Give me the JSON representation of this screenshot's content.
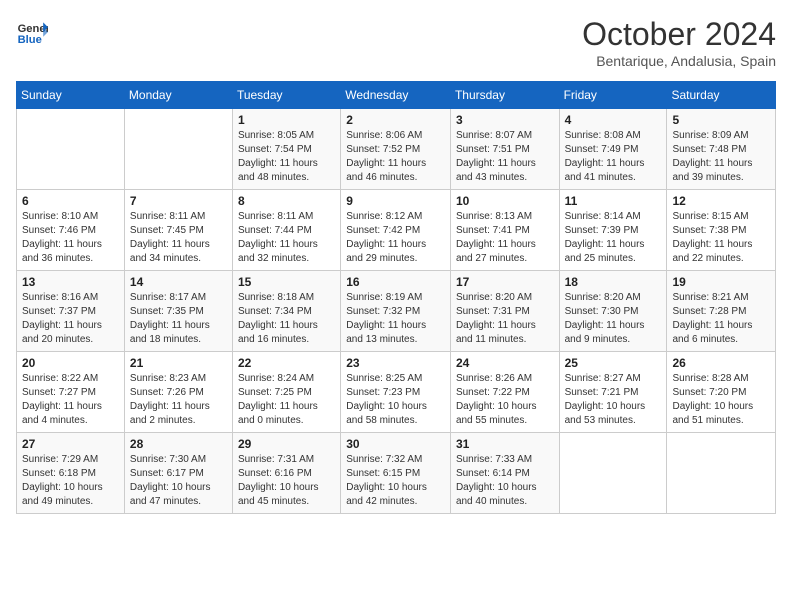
{
  "header": {
    "logo_line1": "General",
    "logo_line2": "Blue",
    "month": "October 2024",
    "location": "Bentarique, Andalusia, Spain"
  },
  "days_of_week": [
    "Sunday",
    "Monday",
    "Tuesday",
    "Wednesday",
    "Thursday",
    "Friday",
    "Saturday"
  ],
  "weeks": [
    [
      {
        "day": "",
        "info": ""
      },
      {
        "day": "",
        "info": ""
      },
      {
        "day": "1",
        "info": "Sunrise: 8:05 AM\nSunset: 7:54 PM\nDaylight: 11 hours and 48 minutes."
      },
      {
        "day": "2",
        "info": "Sunrise: 8:06 AM\nSunset: 7:52 PM\nDaylight: 11 hours and 46 minutes."
      },
      {
        "day": "3",
        "info": "Sunrise: 8:07 AM\nSunset: 7:51 PM\nDaylight: 11 hours and 43 minutes."
      },
      {
        "day": "4",
        "info": "Sunrise: 8:08 AM\nSunset: 7:49 PM\nDaylight: 11 hours and 41 minutes."
      },
      {
        "day": "5",
        "info": "Sunrise: 8:09 AM\nSunset: 7:48 PM\nDaylight: 11 hours and 39 minutes."
      }
    ],
    [
      {
        "day": "6",
        "info": "Sunrise: 8:10 AM\nSunset: 7:46 PM\nDaylight: 11 hours and 36 minutes."
      },
      {
        "day": "7",
        "info": "Sunrise: 8:11 AM\nSunset: 7:45 PM\nDaylight: 11 hours and 34 minutes."
      },
      {
        "day": "8",
        "info": "Sunrise: 8:11 AM\nSunset: 7:44 PM\nDaylight: 11 hours and 32 minutes."
      },
      {
        "day": "9",
        "info": "Sunrise: 8:12 AM\nSunset: 7:42 PM\nDaylight: 11 hours and 29 minutes."
      },
      {
        "day": "10",
        "info": "Sunrise: 8:13 AM\nSunset: 7:41 PM\nDaylight: 11 hours and 27 minutes."
      },
      {
        "day": "11",
        "info": "Sunrise: 8:14 AM\nSunset: 7:39 PM\nDaylight: 11 hours and 25 minutes."
      },
      {
        "day": "12",
        "info": "Sunrise: 8:15 AM\nSunset: 7:38 PM\nDaylight: 11 hours and 22 minutes."
      }
    ],
    [
      {
        "day": "13",
        "info": "Sunrise: 8:16 AM\nSunset: 7:37 PM\nDaylight: 11 hours and 20 minutes."
      },
      {
        "day": "14",
        "info": "Sunrise: 8:17 AM\nSunset: 7:35 PM\nDaylight: 11 hours and 18 minutes."
      },
      {
        "day": "15",
        "info": "Sunrise: 8:18 AM\nSunset: 7:34 PM\nDaylight: 11 hours and 16 minutes."
      },
      {
        "day": "16",
        "info": "Sunrise: 8:19 AM\nSunset: 7:32 PM\nDaylight: 11 hours and 13 minutes."
      },
      {
        "day": "17",
        "info": "Sunrise: 8:20 AM\nSunset: 7:31 PM\nDaylight: 11 hours and 11 minutes."
      },
      {
        "day": "18",
        "info": "Sunrise: 8:20 AM\nSunset: 7:30 PM\nDaylight: 11 hours and 9 minutes."
      },
      {
        "day": "19",
        "info": "Sunrise: 8:21 AM\nSunset: 7:28 PM\nDaylight: 11 hours and 6 minutes."
      }
    ],
    [
      {
        "day": "20",
        "info": "Sunrise: 8:22 AM\nSunset: 7:27 PM\nDaylight: 11 hours and 4 minutes."
      },
      {
        "day": "21",
        "info": "Sunrise: 8:23 AM\nSunset: 7:26 PM\nDaylight: 11 hours and 2 minutes."
      },
      {
        "day": "22",
        "info": "Sunrise: 8:24 AM\nSunset: 7:25 PM\nDaylight: 11 hours and 0 minutes."
      },
      {
        "day": "23",
        "info": "Sunrise: 8:25 AM\nSunset: 7:23 PM\nDaylight: 10 hours and 58 minutes."
      },
      {
        "day": "24",
        "info": "Sunrise: 8:26 AM\nSunset: 7:22 PM\nDaylight: 10 hours and 55 minutes."
      },
      {
        "day": "25",
        "info": "Sunrise: 8:27 AM\nSunset: 7:21 PM\nDaylight: 10 hours and 53 minutes."
      },
      {
        "day": "26",
        "info": "Sunrise: 8:28 AM\nSunset: 7:20 PM\nDaylight: 10 hours and 51 minutes."
      }
    ],
    [
      {
        "day": "27",
        "info": "Sunrise: 7:29 AM\nSunset: 6:18 PM\nDaylight: 10 hours and 49 minutes."
      },
      {
        "day": "28",
        "info": "Sunrise: 7:30 AM\nSunset: 6:17 PM\nDaylight: 10 hours and 47 minutes."
      },
      {
        "day": "29",
        "info": "Sunrise: 7:31 AM\nSunset: 6:16 PM\nDaylight: 10 hours and 45 minutes."
      },
      {
        "day": "30",
        "info": "Sunrise: 7:32 AM\nSunset: 6:15 PM\nDaylight: 10 hours and 42 minutes."
      },
      {
        "day": "31",
        "info": "Sunrise: 7:33 AM\nSunset: 6:14 PM\nDaylight: 10 hours and 40 minutes."
      },
      {
        "day": "",
        "info": ""
      },
      {
        "day": "",
        "info": ""
      }
    ]
  ]
}
